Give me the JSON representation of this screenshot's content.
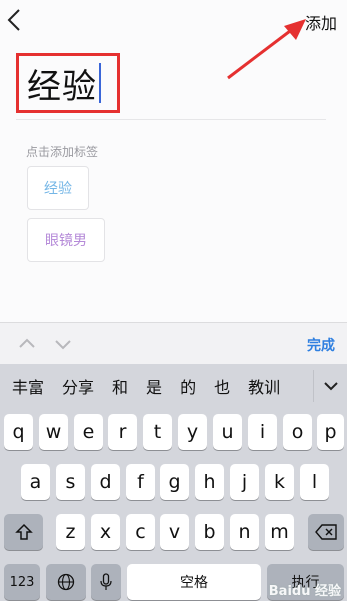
{
  "header": {
    "add_label": "添加"
  },
  "title": {
    "text": "经验"
  },
  "tags_section": {
    "hint": "点击添加标签",
    "tags": [
      "经验",
      "眼镜男"
    ]
  },
  "accessory": {
    "done_label": "完成"
  },
  "candidates": [
    "丰富",
    "分享",
    "和",
    "是",
    "的",
    "也",
    "教训"
  ],
  "keyboard": {
    "row1": [
      "q",
      "w",
      "e",
      "r",
      "t",
      "y",
      "u",
      "i",
      "o",
      "p"
    ],
    "row2": [
      "a",
      "s",
      "d",
      "f",
      "g",
      "h",
      "j",
      "k",
      "l"
    ],
    "row3": [
      "z",
      "x",
      "c",
      "v",
      "b",
      "n",
      "m"
    ],
    "numbers_label": "123",
    "space_label": "空格",
    "return_label": "执行"
  },
  "watermark": {
    "text": "Baidu 经验"
  },
  "colors": {
    "highlight_box": "#e53030",
    "arrow": "#e53030",
    "caret": "#3a66d8",
    "done": "#2e7fe0",
    "tag1_text": "#74b6e6",
    "tag2_text": "#b58ad8"
  },
  "icons": [
    "back-chevron-icon",
    "annotation-arrow",
    "chevron-up-icon",
    "chevron-down-icon",
    "candidate-expand-icon",
    "shift-icon",
    "globe-icon",
    "microphone-icon",
    "delete-icon"
  ]
}
